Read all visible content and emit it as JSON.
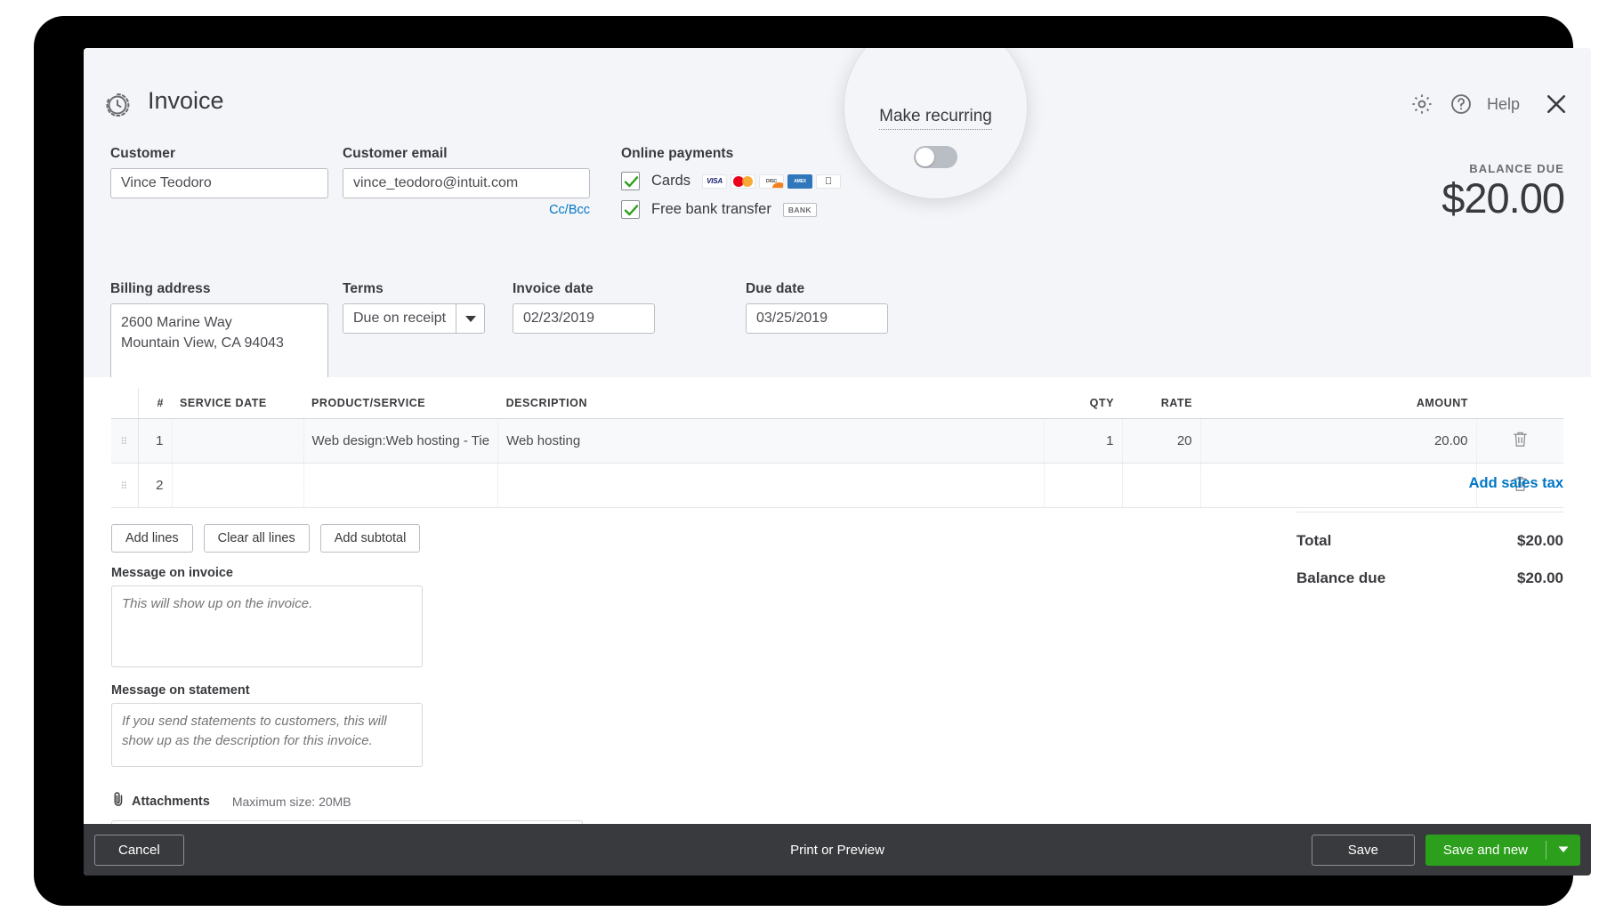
{
  "header": {
    "title": "Invoice",
    "recurring_icon": "recurring-clock-icon",
    "gear_icon": "gear-icon",
    "help_label": "Help",
    "help_icon": "question-circle-icon",
    "close_icon": "close-icon"
  },
  "customer": {
    "label": "Customer",
    "value": "Vince Teodoro"
  },
  "customer_email": {
    "label": "Customer email",
    "value": "vince_teodoro@intuit.com",
    "ccbcc_label": "Cc/Bcc"
  },
  "online_payments": {
    "label": "Online payments",
    "cards": {
      "label": "Cards",
      "checked": true,
      "logos": [
        "VISA",
        "mastercard",
        "DISCOVER",
        "AMEX",
        "applepay"
      ]
    },
    "bank_transfer": {
      "label": "Free bank transfer",
      "checked": true,
      "badge": "BANK"
    }
  },
  "balance_due": {
    "label": "BALANCE DUE",
    "amount": "$20.00"
  },
  "billing_address": {
    "label": "Billing address",
    "line1": "2600 Marine Way",
    "line2": "Mountain View, CA 94043"
  },
  "terms": {
    "label": "Terms",
    "value": "Due on receipt"
  },
  "invoice_date": {
    "label": "Invoice date",
    "value": "02/23/2019"
  },
  "due_date": {
    "label": "Due date",
    "value": "03/25/2019"
  },
  "callout": {
    "title": "Make recurring",
    "toggle_on": false
  },
  "items_table": {
    "columns": [
      "",
      "#",
      "SERVICE DATE",
      "PRODUCT/SERVICE",
      "DESCRIPTION",
      "QTY",
      "RATE",
      "AMOUNT",
      ""
    ],
    "rows": [
      {
        "num": "1",
        "service_date": "",
        "product": "Web design:Web hosting - Tie",
        "description": "Web hosting",
        "qty": "1",
        "rate": "20",
        "amount": "20.00",
        "delete_icon": "trash-icon"
      },
      {
        "num": "2",
        "service_date": "",
        "product": "",
        "description": "",
        "qty": "",
        "rate": "",
        "amount": "",
        "delete_icon": "trash-icon"
      }
    ]
  },
  "line_buttons": {
    "add_lines": "Add lines",
    "clear_all_lines": "Clear all lines",
    "add_subtotal": "Add subtotal"
  },
  "message_on_invoice": {
    "label": "Message on invoice",
    "placeholder": "This will show up on the invoice.",
    "value": ""
  },
  "message_on_statement": {
    "label": "Message on statement",
    "placeholder": "If you send statements to customers, this will show up as the description for this invoice.",
    "value": ""
  },
  "attachments": {
    "label": "Attachments",
    "icon": "paperclip-icon",
    "max_size": "Maximum size: 20MB"
  },
  "totals": {
    "add_sales_tax": "Add sales tax",
    "total_label": "Total",
    "total_value": "$20.00",
    "balance_label": "Balance due",
    "balance_value": "$20.00"
  },
  "footer": {
    "cancel": "Cancel",
    "print_or_preview": "Print or Preview",
    "save": "Save",
    "save_and_new": "Save and new",
    "dropdown_icon": "caret-down-icon"
  },
  "colors": {
    "accent_link": "#0077c5",
    "save_green": "#2ca01c",
    "check_green": "#2ca01c",
    "footer_dark": "#393a3d",
    "page_bg": "#f4f5f8"
  }
}
